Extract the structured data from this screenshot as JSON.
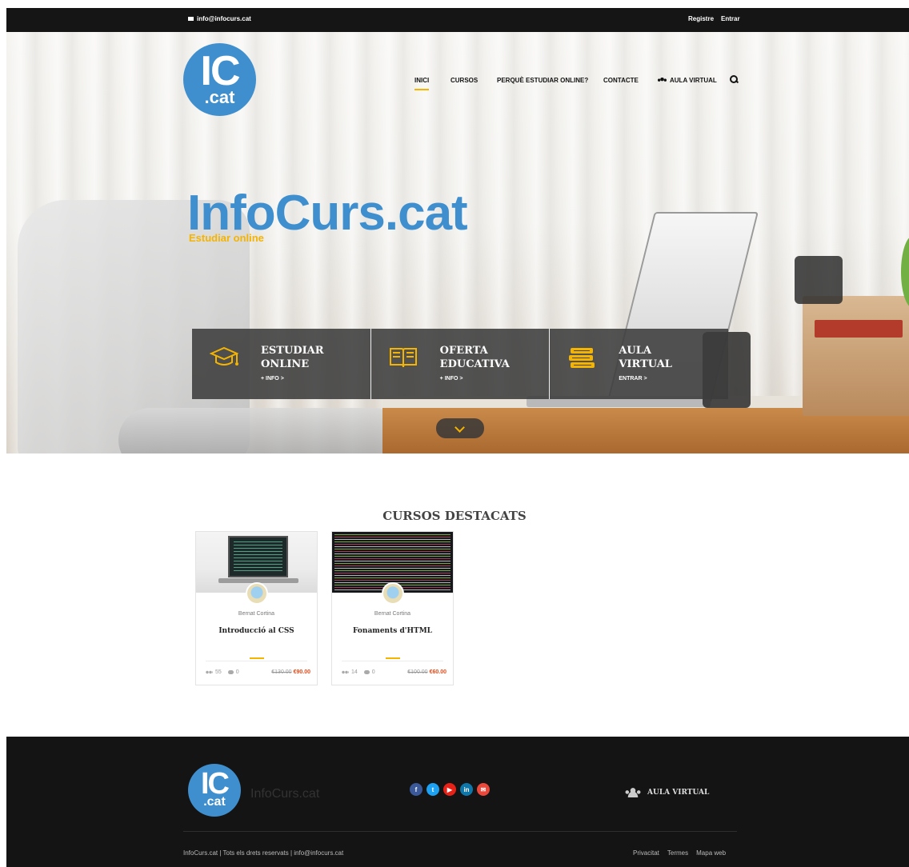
{
  "topbar": {
    "email": "info@infocurs.cat",
    "register_label": "Registre",
    "login_label": "Entrar"
  },
  "logo": {
    "line1": "IC",
    "line2": ".cat"
  },
  "nav": {
    "items": [
      {
        "label": "INICI",
        "active": true
      },
      {
        "label": "CURSOS"
      },
      {
        "label": "PERQUÈ ESTUDIAR ONLINE?"
      },
      {
        "label": "CONTACTE"
      },
      {
        "label": "AULA VIRTUAL"
      }
    ]
  },
  "hero": {
    "title": "InfoCurs.cat",
    "subtitle": "Estudiar online"
  },
  "features": [
    {
      "title_line1": "ESTUDIAR",
      "title_line2": "ONLINE",
      "link": "+ INFO >",
      "icon": "graduation-cap-icon"
    },
    {
      "title_line1": "OFERTA",
      "title_line2": "EDUCATIVA",
      "link": "+ INFO >",
      "icon": "open-book-icon"
    },
    {
      "title_line1": "AULA",
      "title_line2": "VIRTUAL",
      "link": "ENTRAR >",
      "icon": "books-stack-icon"
    }
  ],
  "featured": {
    "title": "CURSOS DESTACATS",
    "courses": [
      {
        "author": "Bernat Cortina",
        "title": "Introducció al CSS",
        "students": "55",
        "comments": "0",
        "old_price": "€130.00",
        "price": "€90.00"
      },
      {
        "author": "Bernat Cortina",
        "title": "Fonaments d'HTML",
        "students": "14",
        "comments": "0",
        "old_price": "€100.00",
        "price": "€60.00"
      }
    ]
  },
  "footer": {
    "brand": "InfoCurs.cat",
    "socials": [
      {
        "name": "facebook-icon",
        "glyph": "f",
        "color": "#3b5998"
      },
      {
        "name": "twitter-icon",
        "glyph": "t",
        "color": "#1da1f2"
      },
      {
        "name": "youtube-icon",
        "glyph": "▶",
        "color": "#e62117"
      },
      {
        "name": "linkedin-icon",
        "glyph": "in",
        "color": "#0e76a8"
      },
      {
        "name": "email-icon",
        "glyph": "✉",
        "color": "#e9483b"
      }
    ],
    "aula_label": "AULA VIRTUAL",
    "copyright": "InfoCurs.cat | Tots els drets reservats | info@infocurs.cat",
    "links": [
      "Privacitat",
      "Termes",
      "Mapa web"
    ]
  },
  "colors": {
    "brand_blue": "#3f8fcf",
    "accent_yellow": "#f5b400",
    "sale_price": "#e64a19",
    "dark": "#151515"
  }
}
